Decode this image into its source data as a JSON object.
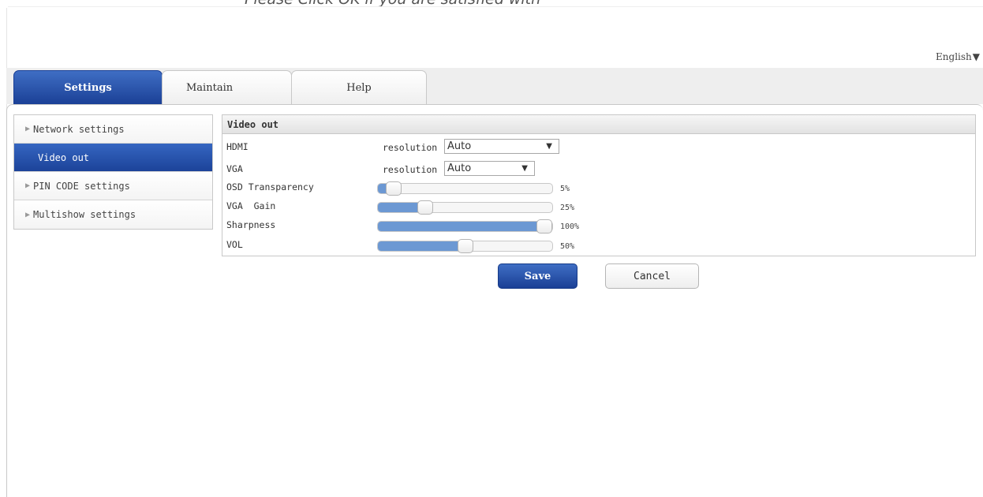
{
  "top_caption": "Please Click OK if you are satisfied with",
  "language": {
    "label": "English",
    "arrow": "▼"
  },
  "tabs": [
    {
      "label": "Settings",
      "active": true
    },
    {
      "label": "Maintain",
      "active": false
    },
    {
      "label": "Help",
      "active": false
    }
  ],
  "sidebar": {
    "items": [
      {
        "label": "Network settings",
        "marker": "▶",
        "active": false
      },
      {
        "label": "Video out",
        "marker": "",
        "active": true
      },
      {
        "label": "PIN CODE settings",
        "marker": "▶",
        "active": false
      },
      {
        "label": "Multishow settings",
        "marker": "▶",
        "active": false
      }
    ]
  },
  "panel": {
    "title": "Video out",
    "hdmi": {
      "label": "HDMI",
      "sub_label": "resolution",
      "value": "Auto"
    },
    "vga": {
      "label": "VGA",
      "sub_label": "resolution",
      "value": "Auto"
    },
    "osd": {
      "label": "OSD Transparency",
      "value": 5,
      "value_text": "5%"
    },
    "vga_gain": {
      "label": "VGA  Gain",
      "value": 25,
      "value_text": "25%"
    },
    "sharpness": {
      "label": "Sharpness",
      "value": 100,
      "value_text": "100%"
    },
    "vol": {
      "label": "VOL",
      "value": 50,
      "value_text": "50%"
    }
  },
  "buttons": {
    "save": "Save",
    "cancel": "Cancel"
  },
  "colors": {
    "accent": "#1c4399",
    "slider_fill": "#6c98d3"
  }
}
